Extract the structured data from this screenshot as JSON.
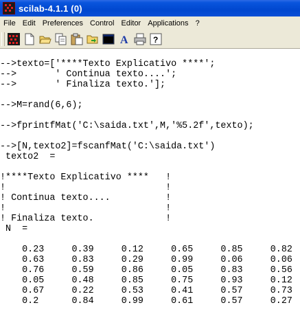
{
  "window": {
    "title": "scilab-4.1.1 (0)"
  },
  "menu": {
    "items": [
      "File",
      "Edit",
      "Preferences",
      "Control",
      "Editor",
      "Applications",
      "?"
    ]
  },
  "toolbar": {
    "buttons": [
      {
        "icon": "scilab-logo-icon"
      },
      {
        "icon": "new-file-icon"
      },
      {
        "icon": "open-folder-icon"
      },
      {
        "icon": "copy-icon"
      },
      {
        "icon": "paste-icon"
      },
      {
        "icon": "change-directory-icon"
      },
      {
        "icon": "scinotes-console-icon"
      },
      {
        "icon": "font-icon"
      },
      {
        "icon": "print-icon"
      },
      {
        "icon": "help-icon"
      }
    ]
  },
  "console": {
    "lines": [
      "",
      "-->texto=['****Texto Explicativo ****';",
      "-->       ' Continua texto....';",
      "-->       ' Finaliza texto.'];",
      "",
      "-->M=rand(6,6);",
      "",
      "-->fprintfMat('C:\\saida.txt',M,'%5.2f',texto);",
      "",
      "-->[N,texto2]=fscanfMat('C:\\saida.txt')",
      " texto2  =",
      "",
      "!****Texto Explicativo ****   !",
      "!                             !",
      "! Continua texto....          !",
      "!                             !",
      "! Finaliza texto.             !",
      " N  =",
      "",
      "    0.23     0.39     0.12     0.65     0.85     0.82",
      "    0.63     0.83     0.29     0.99     0.06     0.06",
      "    0.76     0.59     0.86     0.05     0.83     0.56",
      "    0.05     0.48     0.85     0.75     0.93     0.12",
      "    0.67     0.22     0.53     0.41     0.57     0.73",
      "    0.2      0.84     0.99     0.61     0.57     0.27"
    ]
  }
}
